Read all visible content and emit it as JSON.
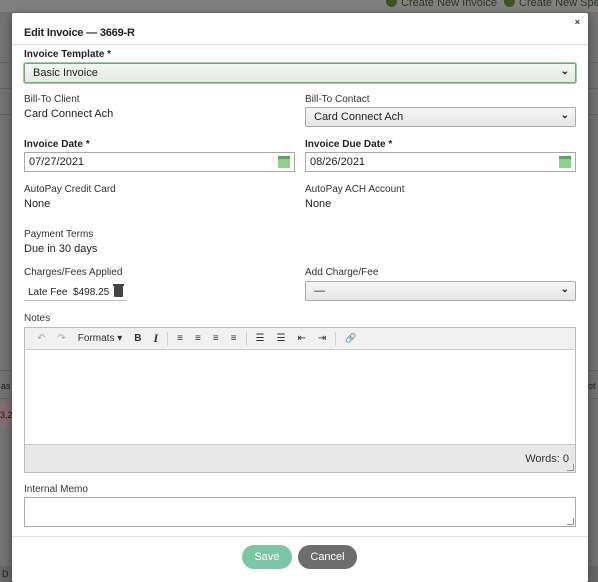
{
  "background": {
    "link1": "Create New Invoice",
    "link2": "Create New Spe",
    "col_left": "as",
    "col_right": "ot",
    "cell_value": "3,2",
    "bottom_text": "D"
  },
  "modal": {
    "title": "Edit Invoice — 3669-R",
    "close": "×",
    "invoice_template": {
      "label": "Invoice Template *",
      "value": "Basic Invoice"
    },
    "bill_to_client": {
      "label": "Bill-To Client",
      "value": "Card Connect Ach"
    },
    "bill_to_contact": {
      "label": "Bill-To Contact",
      "value": "Card Connect Ach"
    },
    "invoice_date": {
      "label": "Invoice Date *",
      "value": "07/27/2021"
    },
    "due_date": {
      "label": "Invoice Due Date *",
      "value": "08/26/2021"
    },
    "autopay_cc": {
      "label": "AutoPay Credit Card",
      "value": "None"
    },
    "autopay_ach": {
      "label": "AutoPay ACH Account",
      "value": "None"
    },
    "payment_terms": {
      "label": "Payment Terms",
      "value": "Due in 30 days"
    },
    "charges": {
      "label": "Charges/Fees Applied",
      "fee_name": "Late Fee",
      "fee_amount": "$498.25"
    },
    "add_charge": {
      "label": "Add Charge/Fee",
      "value": "—"
    },
    "notes": {
      "label": "Notes",
      "toolbar": {
        "undo": "↶",
        "redo": "↷",
        "formats": "Formats ▾",
        "bold": "B",
        "italic": "I",
        "align_left": "≡",
        "align_center": "≡",
        "align_right": "≡",
        "justify": "≡",
        "bullets": "☰",
        "numbered": "☰",
        "outdent": "⇤",
        "indent": "⇥",
        "link": "🔗"
      },
      "words": "Words: 0"
    },
    "internal_memo": {
      "label": "Internal Memo"
    },
    "buttons": {
      "save": "Save",
      "cancel": "Cancel"
    }
  }
}
